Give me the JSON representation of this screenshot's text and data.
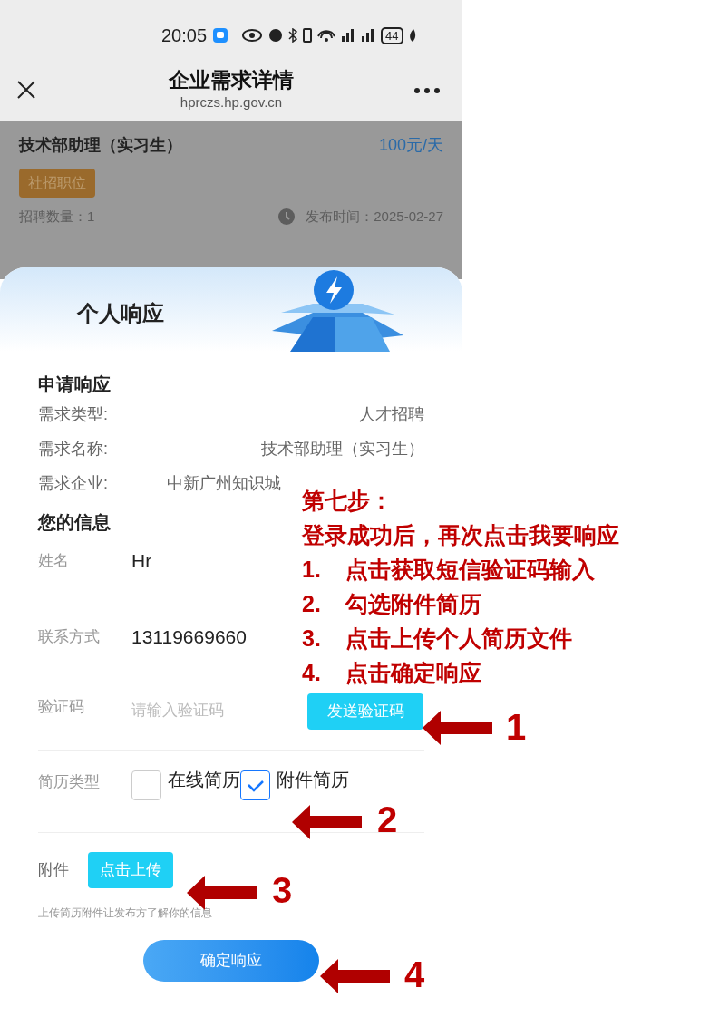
{
  "status_bar": {
    "time": "20:05",
    "battery": "44"
  },
  "header": {
    "title": "企业需求详情",
    "url": "hprczs.hp.gov.cn"
  },
  "job": {
    "title": "技术部助理（实习生）",
    "salary": "100元/天",
    "tag": "社招职位",
    "count": "招聘数量：1",
    "published": "发布时间：2025-02-27"
  },
  "sheet": {
    "title": "个人响应",
    "section_1": "申请响应",
    "details": [
      {
        "label": "需求类型:",
        "value": "人才招聘"
      },
      {
        "label": "需求名称:",
        "value": "技术部助理（实习生）"
      },
      {
        "label": "需求企业:",
        "value": "中新广州知识城"
      }
    ],
    "section_2": "您的信息",
    "fields": [
      {
        "kind": "text",
        "label": "姓名",
        "value": "Hr"
      },
      {
        "kind": "text",
        "label": "联系方式",
        "value": "13119669660"
      },
      {
        "kind": "code",
        "label": "验证码",
        "placeholder": "请输入验证码",
        "button": "发送验证码"
      }
    ],
    "resume_type": {
      "label": "简历类型",
      "options": [
        {
          "label": "在线简历",
          "checked": false
        },
        {
          "label": "附件简历",
          "checked": true
        }
      ]
    },
    "attachment": {
      "label": "附件",
      "button": "点击上传"
    },
    "hint": "上传简历附件让发布方了解你的信息",
    "submit": "确定响应"
  },
  "annotation": {
    "title": "第七步：",
    "intro": "登录成功后，再次点击我要响应",
    "steps": [
      {
        "number": "1.",
        "text": "点击获取短信验证码输入"
      },
      {
        "number": "2.",
        "text": "勾选附件简历"
      },
      {
        "number": "3.",
        "text": "点击上传个人简历文件"
      },
      {
        "number": "4.",
        "text": "点击确定响应"
      }
    ],
    "markers": [
      "1",
      "2",
      "3",
      "4"
    ]
  }
}
